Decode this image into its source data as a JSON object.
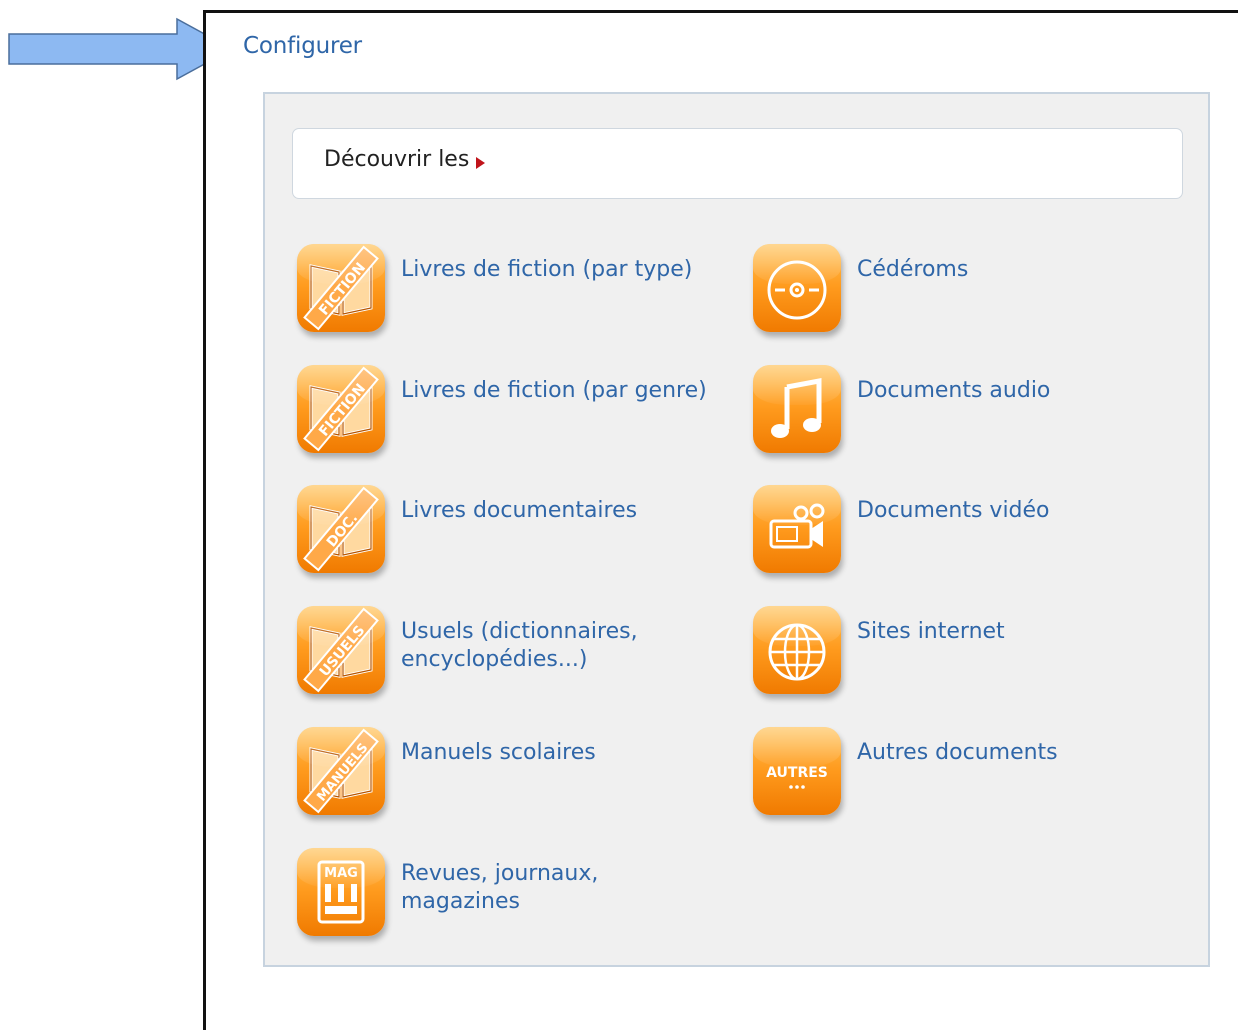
{
  "header": {
    "configure_label": "Configurer"
  },
  "discover": {
    "label": "Découvrir les"
  },
  "colors": {
    "link": "#2f66a8",
    "tile_top": "#ffc257",
    "tile_bottom": "#f07a00",
    "arrow_fill": "#8db9f2",
    "arrow_stroke": "#4a6e9c",
    "discover_triangle": "#c0141b"
  },
  "left_column": [
    {
      "label": "Livres de fiction (par type)",
      "icon": "fiction-book-icon",
      "icon_text": "FICTION"
    },
    {
      "label": "Livres de fiction (par genre)",
      "icon": "fiction-book-icon",
      "icon_text": "FICTION"
    },
    {
      "label": "Livres documentaires",
      "icon": "doc-book-icon",
      "icon_text": "DOC."
    },
    {
      "label": "Usuels (dictionnaires, encyclopédies...)",
      "icon": "usuels-book-icon",
      "icon_text": "USUELS"
    },
    {
      "label": "Manuels scolaires",
      "icon": "manuels-book-icon",
      "icon_text": "MANUELS"
    },
    {
      "label": "Revues, journaux, magazines",
      "icon": "magazine-icon",
      "icon_text": "MAG"
    }
  ],
  "right_column": [
    {
      "label": "Cédéroms",
      "icon": "cd-icon"
    },
    {
      "label": "Documents audio",
      "icon": "music-note-icon"
    },
    {
      "label": "Documents vidéo",
      "icon": "video-camera-icon"
    },
    {
      "label": "Sites internet",
      "icon": "globe-icon"
    },
    {
      "label": "Autres documents",
      "icon": "autres-icon",
      "icon_text": "AUTRES"
    }
  ]
}
